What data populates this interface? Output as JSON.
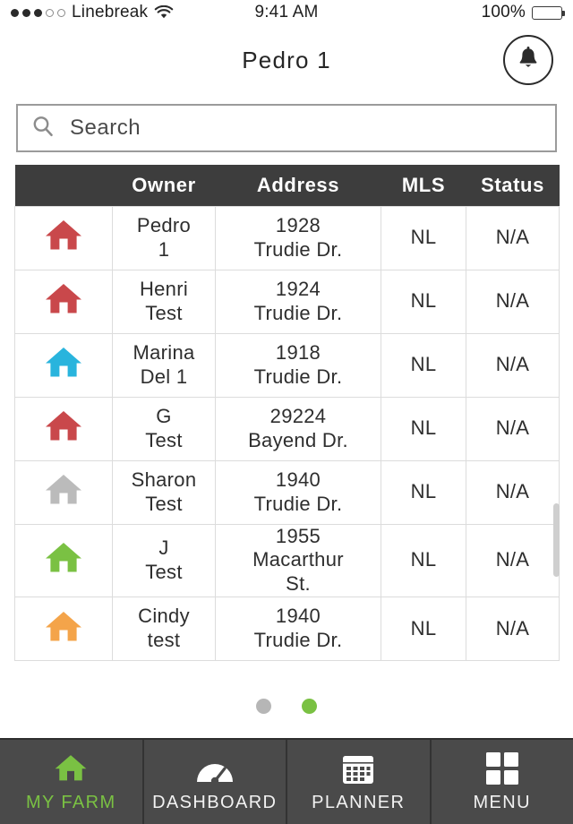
{
  "statusbar": {
    "carrier": "Linebreak",
    "time": "9:41 AM",
    "battery_percent": "100%",
    "signal_filled": 3,
    "signal_empty": 2,
    "wifi_icon": "wifi-icon",
    "battery_icon": "battery-full-icon"
  },
  "header": {
    "title": "Pedro 1",
    "bell_icon": "bell-icon"
  },
  "search": {
    "placeholder": "Search",
    "value": "",
    "icon": "search-icon"
  },
  "table": {
    "columns": [
      "",
      "Owner",
      "Address",
      "MLS",
      "Status"
    ],
    "rows": [
      {
        "icon": "house-icon",
        "icon_color": "#c9484b",
        "owner": "Pedro\n1",
        "address": "1928\nTrudie Dr.",
        "mls": "NL",
        "status": "N/A"
      },
      {
        "icon": "house-icon",
        "icon_color": "#c9484b",
        "owner": "Henri\nTest",
        "address": "1924\nTrudie Dr.",
        "mls": "NL",
        "status": "N/A"
      },
      {
        "icon": "house-icon",
        "icon_color": "#29b4dd",
        "owner": "Marina\nDel 1",
        "address": "1918\nTrudie Dr.",
        "mls": "NL",
        "status": "N/A"
      },
      {
        "icon": "house-icon",
        "icon_color": "#c9484b",
        "owner": "G\nTest",
        "address": "29224\nBayend Dr.",
        "mls": "NL",
        "status": "N/A"
      },
      {
        "icon": "house-icon",
        "icon_color": "#bbbbbb",
        "owner": "Sharon\nTest",
        "address": "1940\nTrudie Dr.",
        "mls": "NL",
        "status": "N/A"
      },
      {
        "icon": "house-icon",
        "icon_color": "#7ac143",
        "owner": "J\nTest",
        "address": "1955\nMacarthur\nSt.",
        "mls": "NL",
        "status": "N/A"
      },
      {
        "icon": "house-icon",
        "icon_color": "#f4a44a",
        "owner": "Cindy\ntest",
        "address": "1940\nTrudie Dr.",
        "mls": "NL",
        "status": "N/A"
      }
    ]
  },
  "pager": {
    "dots": [
      {
        "active": false
      },
      {
        "active": true
      }
    ]
  },
  "tabbar": {
    "items": [
      {
        "label": "MY FARM",
        "icon": "home-icon",
        "active": true
      },
      {
        "label": "DASHBOARD",
        "icon": "speedometer-icon",
        "active": false
      },
      {
        "label": "PLANNER",
        "icon": "calendar-icon",
        "active": false
      },
      {
        "label": "MENU",
        "icon": "grid-icon",
        "active": false
      }
    ]
  },
  "colors": {
    "accent_green": "#7ac143",
    "header_bar": "#3d3d3d",
    "tabbar": "#4a4a4a",
    "border": "#dcdcdc"
  }
}
